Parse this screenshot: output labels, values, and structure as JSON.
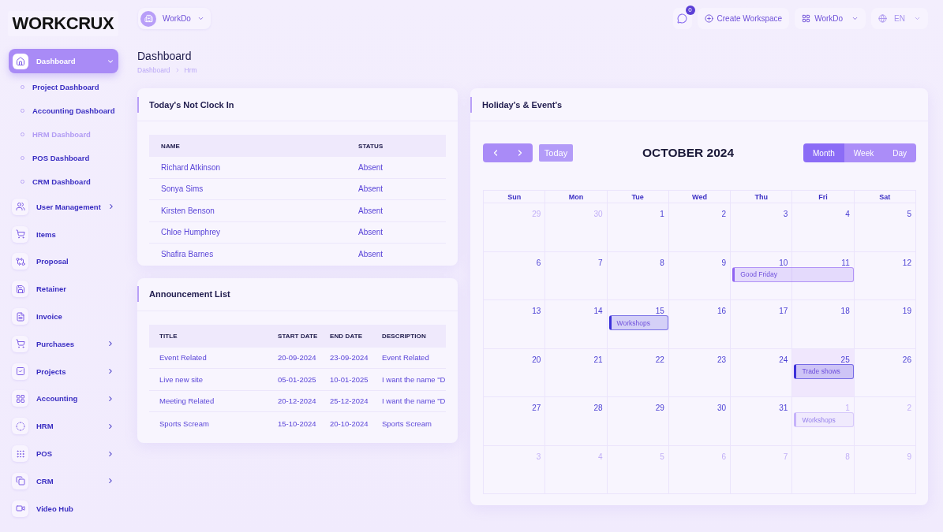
{
  "logo": {
    "text": "WORKCRUX"
  },
  "sidebar": {
    "items": [
      {
        "label": "Dashboard",
        "selected": true,
        "expanded": true,
        "children": [
          {
            "label": "Project Dashboard",
            "selected": false
          },
          {
            "label": "Accounting Dashboard",
            "selected": false
          },
          {
            "label": "HRM Dashboard",
            "selected": true
          },
          {
            "label": "POS Dashboard",
            "selected": false
          },
          {
            "label": "CRM Dashboard",
            "selected": false
          }
        ]
      },
      {
        "label": "User Management",
        "selected": false,
        "expanded": false
      },
      {
        "label": "Items",
        "selected": false
      },
      {
        "label": "Proposal",
        "selected": false
      },
      {
        "label": "Retainer",
        "selected": false
      },
      {
        "label": "Invoice",
        "selected": false
      },
      {
        "label": "Purchases",
        "selected": false,
        "expanded": false
      },
      {
        "label": "Projects",
        "selected": false,
        "expanded": false
      },
      {
        "label": "Accounting",
        "selected": false,
        "expanded": false
      },
      {
        "label": "HRM",
        "selected": false,
        "expanded": false
      },
      {
        "label": "POS",
        "selected": false,
        "expanded": false
      },
      {
        "label": "CRM",
        "selected": false,
        "expanded": false
      },
      {
        "label": "Video Hub",
        "selected": false
      }
    ]
  },
  "topbar": {
    "workspace": {
      "label": "WorkDo"
    },
    "notifications": {
      "count": "0"
    },
    "create_button": {
      "label": "Create Workspace"
    },
    "workspace_menu": {
      "label": "WorkDo"
    },
    "language": {
      "label": "EN"
    }
  },
  "page": {
    "title": "Dashboard",
    "breadcrumb": [
      "Dashboard",
      "Hrm"
    ]
  },
  "not_clocked_in": {
    "title": "Today's Not Clock In",
    "columns": [
      "NAME",
      "STATUS"
    ],
    "rows": [
      [
        "Richard Atkinson",
        "Absent"
      ],
      [
        "Sonya Sims",
        "Absent"
      ],
      [
        "Kirsten Benson",
        "Absent"
      ],
      [
        "Chloe Humphrey",
        "Absent"
      ],
      [
        "Shafira Barnes",
        "Absent"
      ]
    ]
  },
  "announcements": {
    "title": "Announcement List",
    "columns": [
      "TITLE",
      "START DATE",
      "END DATE",
      "DESCRIPTION"
    ],
    "rows": [
      [
        "Event Related",
        "20-09-2024",
        "23-09-2024",
        "Event Related"
      ],
      [
        "Live new site",
        "05-01-2025",
        "10-01-2025",
        "I want the name \"D"
      ],
      [
        "Meeting Related",
        "20-12-2024",
        "25-12-2024",
        "I want the name \"D"
      ],
      [
        "Sports Scream",
        "15-10-2024",
        "20-10-2024",
        "Sports Scream"
      ]
    ]
  },
  "calendar": {
    "title": "Holiday's & Event's",
    "month": "OCTOBER 2024",
    "today_button": {
      "label": "Today",
      "disabled": true
    },
    "views": [
      {
        "label": "Month",
        "selected": true
      },
      {
        "label": "Week",
        "selected": false
      },
      {
        "label": "Day",
        "selected": false
      }
    ],
    "weekdays": [
      "Sun",
      "Mon",
      "Tue",
      "Wed",
      "Thu",
      "Fri",
      "Sat"
    ],
    "weeks": [
      {
        "days": [
          {
            "number": "29",
            "outside": true,
            "today": false
          },
          {
            "number": "30",
            "outside": true,
            "today": false
          },
          {
            "number": "1",
            "outside": false,
            "today": false
          },
          {
            "number": "2",
            "outside": false,
            "today": false
          },
          {
            "number": "3",
            "outside": false,
            "today": false
          },
          {
            "number": "4",
            "outside": false,
            "today": false
          },
          {
            "number": "5",
            "outside": false,
            "today": false
          }
        ]
      },
      {
        "days": [
          {
            "number": "6",
            "outside": false,
            "today": false
          },
          {
            "number": "7",
            "outside": false,
            "today": false
          },
          {
            "number": "8",
            "outside": false,
            "today": false
          },
          {
            "number": "9",
            "outside": false,
            "today": false
          },
          {
            "number": "10",
            "outside": false,
            "today": false,
            "events": [
              {
                "title": "Good Friday",
                "color": "#8f63f2",
                "spans_next_day": true
              }
            ]
          },
          {
            "number": "11",
            "outside": false,
            "today": false
          },
          {
            "number": "12",
            "outside": false,
            "today": false
          }
        ]
      },
      {
        "days": [
          {
            "number": "13",
            "outside": false,
            "today": false
          },
          {
            "number": "14",
            "outside": false,
            "today": false
          },
          {
            "number": "15",
            "outside": false,
            "today": false,
            "events": [
              {
                "title": "Workshops",
                "color": "#3b30d9",
                "spans_next_day": false
              }
            ]
          },
          {
            "number": "16",
            "outside": false,
            "today": false
          },
          {
            "number": "17",
            "outside": false,
            "today": false
          },
          {
            "number": "18",
            "outside": false,
            "today": false
          },
          {
            "number": "19",
            "outside": false,
            "today": false
          }
        ]
      },
      {
        "days": [
          {
            "number": "20",
            "outside": false,
            "today": false
          },
          {
            "number": "21",
            "outside": false,
            "today": false
          },
          {
            "number": "22",
            "outside": false,
            "today": false
          },
          {
            "number": "23",
            "outside": false,
            "today": false
          },
          {
            "number": "24",
            "outside": false,
            "today": false
          },
          {
            "number": "25",
            "outside": false,
            "today": true,
            "events": [
              {
                "title": "Trade shows",
                "color": "#3b30d9",
                "spans_next_day": false
              }
            ]
          },
          {
            "number": "26",
            "outside": false,
            "today": false
          }
        ]
      },
      {
        "days": [
          {
            "number": "27",
            "outside": false,
            "today": false
          },
          {
            "number": "28",
            "outside": false,
            "today": false
          },
          {
            "number": "29",
            "outside": false,
            "today": false
          },
          {
            "number": "30",
            "outside": false,
            "today": false
          },
          {
            "number": "31",
            "outside": false,
            "today": false
          },
          {
            "number": "1",
            "outside": true,
            "today": false,
            "events": [
              {
                "title": "Workshops",
                "color": "#c6b3fa",
                "spans_next_day": false
              }
            ]
          },
          {
            "number": "2",
            "outside": true,
            "today": false
          }
        ]
      },
      {
        "days": [
          {
            "number": "3",
            "outside": true,
            "today": false
          },
          {
            "number": "4",
            "outside": true,
            "today": false
          },
          {
            "number": "5",
            "outside": true,
            "today": false
          },
          {
            "number": "6",
            "outside": true,
            "today": false
          },
          {
            "number": "7",
            "outside": true,
            "today": false
          },
          {
            "number": "8",
            "outside": true,
            "today": false
          },
          {
            "number": "9",
            "outside": true,
            "today": false
          }
        ]
      }
    ]
  }
}
